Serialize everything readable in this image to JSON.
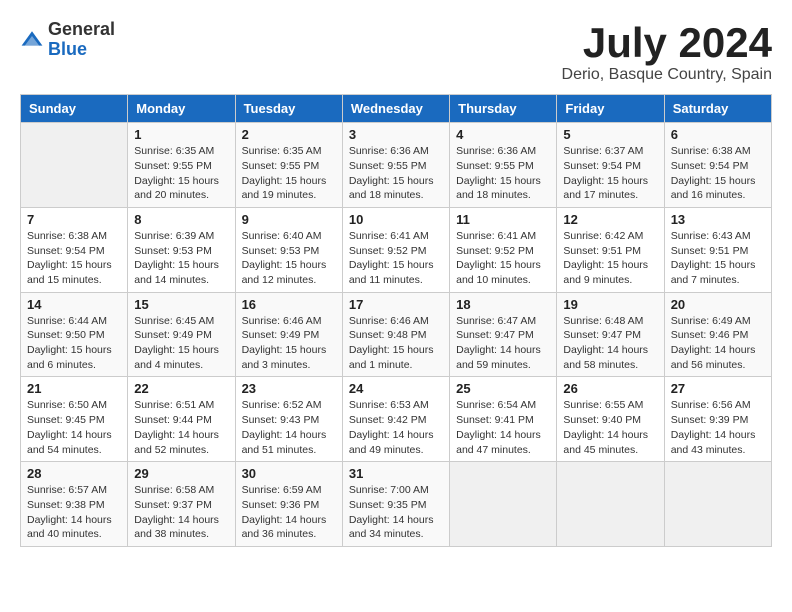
{
  "logo": {
    "general": "General",
    "blue": "Blue"
  },
  "title": "July 2024",
  "location": "Derio, Basque Country, Spain",
  "days_header": [
    "Sunday",
    "Monday",
    "Tuesday",
    "Wednesday",
    "Thursday",
    "Friday",
    "Saturday"
  ],
  "weeks": [
    [
      {
        "day": "",
        "info": ""
      },
      {
        "day": "1",
        "info": "Sunrise: 6:35 AM\nSunset: 9:55 PM\nDaylight: 15 hours\nand 20 minutes."
      },
      {
        "day": "2",
        "info": "Sunrise: 6:35 AM\nSunset: 9:55 PM\nDaylight: 15 hours\nand 19 minutes."
      },
      {
        "day": "3",
        "info": "Sunrise: 6:36 AM\nSunset: 9:55 PM\nDaylight: 15 hours\nand 18 minutes."
      },
      {
        "day": "4",
        "info": "Sunrise: 6:36 AM\nSunset: 9:55 PM\nDaylight: 15 hours\nand 18 minutes."
      },
      {
        "day": "5",
        "info": "Sunrise: 6:37 AM\nSunset: 9:54 PM\nDaylight: 15 hours\nand 17 minutes."
      },
      {
        "day": "6",
        "info": "Sunrise: 6:38 AM\nSunset: 9:54 PM\nDaylight: 15 hours\nand 16 minutes."
      }
    ],
    [
      {
        "day": "7",
        "info": "Sunrise: 6:38 AM\nSunset: 9:54 PM\nDaylight: 15 hours\nand 15 minutes."
      },
      {
        "day": "8",
        "info": "Sunrise: 6:39 AM\nSunset: 9:53 PM\nDaylight: 15 hours\nand 14 minutes."
      },
      {
        "day": "9",
        "info": "Sunrise: 6:40 AM\nSunset: 9:53 PM\nDaylight: 15 hours\nand 12 minutes."
      },
      {
        "day": "10",
        "info": "Sunrise: 6:41 AM\nSunset: 9:52 PM\nDaylight: 15 hours\nand 11 minutes."
      },
      {
        "day": "11",
        "info": "Sunrise: 6:41 AM\nSunset: 9:52 PM\nDaylight: 15 hours\nand 10 minutes."
      },
      {
        "day": "12",
        "info": "Sunrise: 6:42 AM\nSunset: 9:51 PM\nDaylight: 15 hours\nand 9 minutes."
      },
      {
        "day": "13",
        "info": "Sunrise: 6:43 AM\nSunset: 9:51 PM\nDaylight: 15 hours\nand 7 minutes."
      }
    ],
    [
      {
        "day": "14",
        "info": "Sunrise: 6:44 AM\nSunset: 9:50 PM\nDaylight: 15 hours\nand 6 minutes."
      },
      {
        "day": "15",
        "info": "Sunrise: 6:45 AM\nSunset: 9:49 PM\nDaylight: 15 hours\nand 4 minutes."
      },
      {
        "day": "16",
        "info": "Sunrise: 6:46 AM\nSunset: 9:49 PM\nDaylight: 15 hours\nand 3 minutes."
      },
      {
        "day": "17",
        "info": "Sunrise: 6:46 AM\nSunset: 9:48 PM\nDaylight: 15 hours\nand 1 minute."
      },
      {
        "day": "18",
        "info": "Sunrise: 6:47 AM\nSunset: 9:47 PM\nDaylight: 14 hours\nand 59 minutes."
      },
      {
        "day": "19",
        "info": "Sunrise: 6:48 AM\nSunset: 9:47 PM\nDaylight: 14 hours\nand 58 minutes."
      },
      {
        "day": "20",
        "info": "Sunrise: 6:49 AM\nSunset: 9:46 PM\nDaylight: 14 hours\nand 56 minutes."
      }
    ],
    [
      {
        "day": "21",
        "info": "Sunrise: 6:50 AM\nSunset: 9:45 PM\nDaylight: 14 hours\nand 54 minutes."
      },
      {
        "day": "22",
        "info": "Sunrise: 6:51 AM\nSunset: 9:44 PM\nDaylight: 14 hours\nand 52 minutes."
      },
      {
        "day": "23",
        "info": "Sunrise: 6:52 AM\nSunset: 9:43 PM\nDaylight: 14 hours\nand 51 minutes."
      },
      {
        "day": "24",
        "info": "Sunrise: 6:53 AM\nSunset: 9:42 PM\nDaylight: 14 hours\nand 49 minutes."
      },
      {
        "day": "25",
        "info": "Sunrise: 6:54 AM\nSunset: 9:41 PM\nDaylight: 14 hours\nand 47 minutes."
      },
      {
        "day": "26",
        "info": "Sunrise: 6:55 AM\nSunset: 9:40 PM\nDaylight: 14 hours\nand 45 minutes."
      },
      {
        "day": "27",
        "info": "Sunrise: 6:56 AM\nSunset: 9:39 PM\nDaylight: 14 hours\nand 43 minutes."
      }
    ],
    [
      {
        "day": "28",
        "info": "Sunrise: 6:57 AM\nSunset: 9:38 PM\nDaylight: 14 hours\nand 40 minutes."
      },
      {
        "day": "29",
        "info": "Sunrise: 6:58 AM\nSunset: 9:37 PM\nDaylight: 14 hours\nand 38 minutes."
      },
      {
        "day": "30",
        "info": "Sunrise: 6:59 AM\nSunset: 9:36 PM\nDaylight: 14 hours\nand 36 minutes."
      },
      {
        "day": "31",
        "info": "Sunrise: 7:00 AM\nSunset: 9:35 PM\nDaylight: 14 hours\nand 34 minutes."
      },
      {
        "day": "",
        "info": ""
      },
      {
        "day": "",
        "info": ""
      },
      {
        "day": "",
        "info": ""
      }
    ]
  ]
}
